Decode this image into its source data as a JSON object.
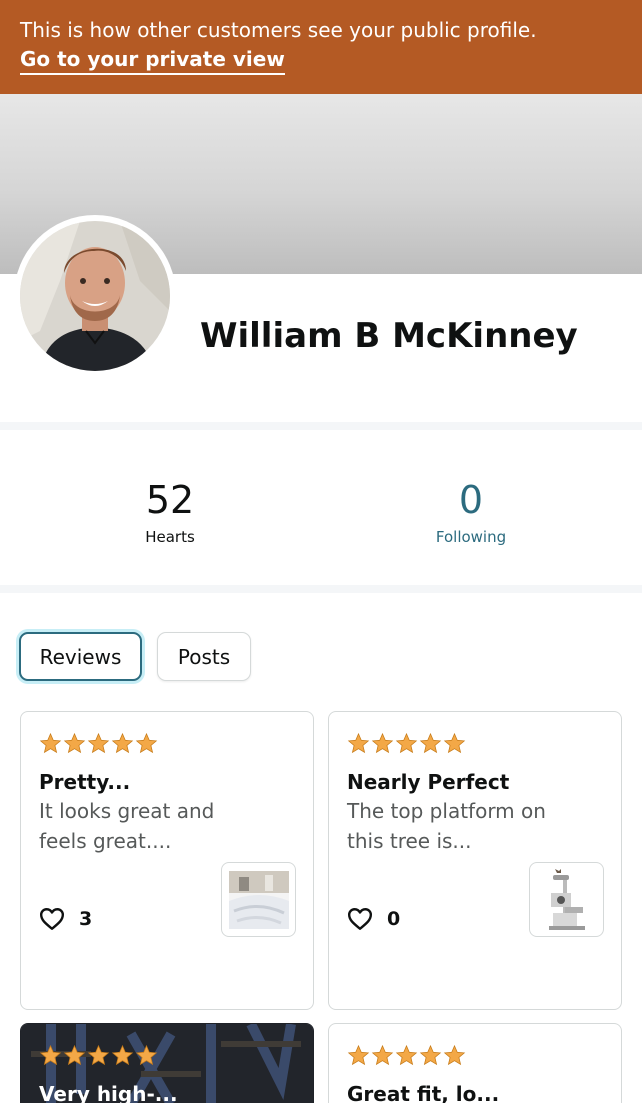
{
  "banner": {
    "text": "This is how other customers see your public profile.",
    "link": "Go to your private view"
  },
  "profile": {
    "name": "William B McKinney"
  },
  "stats": {
    "hearts": {
      "value": "52",
      "label": "Hearts"
    },
    "following": {
      "value": "0",
      "label": "Following"
    }
  },
  "tabs": {
    "reviews": "Reviews",
    "posts": "Posts"
  },
  "reviews": [
    {
      "rating": 5,
      "title": "Pretty...",
      "body": "It looks great and feels great....",
      "likes": "3"
    },
    {
      "rating": 5,
      "title": "Nearly Perfect",
      "body": "The top platform on this tree is...",
      "likes": "0"
    },
    {
      "rating": 5,
      "title": "Very high-...",
      "body": "",
      "likes": ""
    },
    {
      "rating": 5,
      "title": "Great fit, lo...",
      "body": "",
      "likes": ""
    }
  ],
  "colors": {
    "banner": "#b45a24",
    "star": "#f3a847",
    "accent": "#2c6b7f"
  }
}
